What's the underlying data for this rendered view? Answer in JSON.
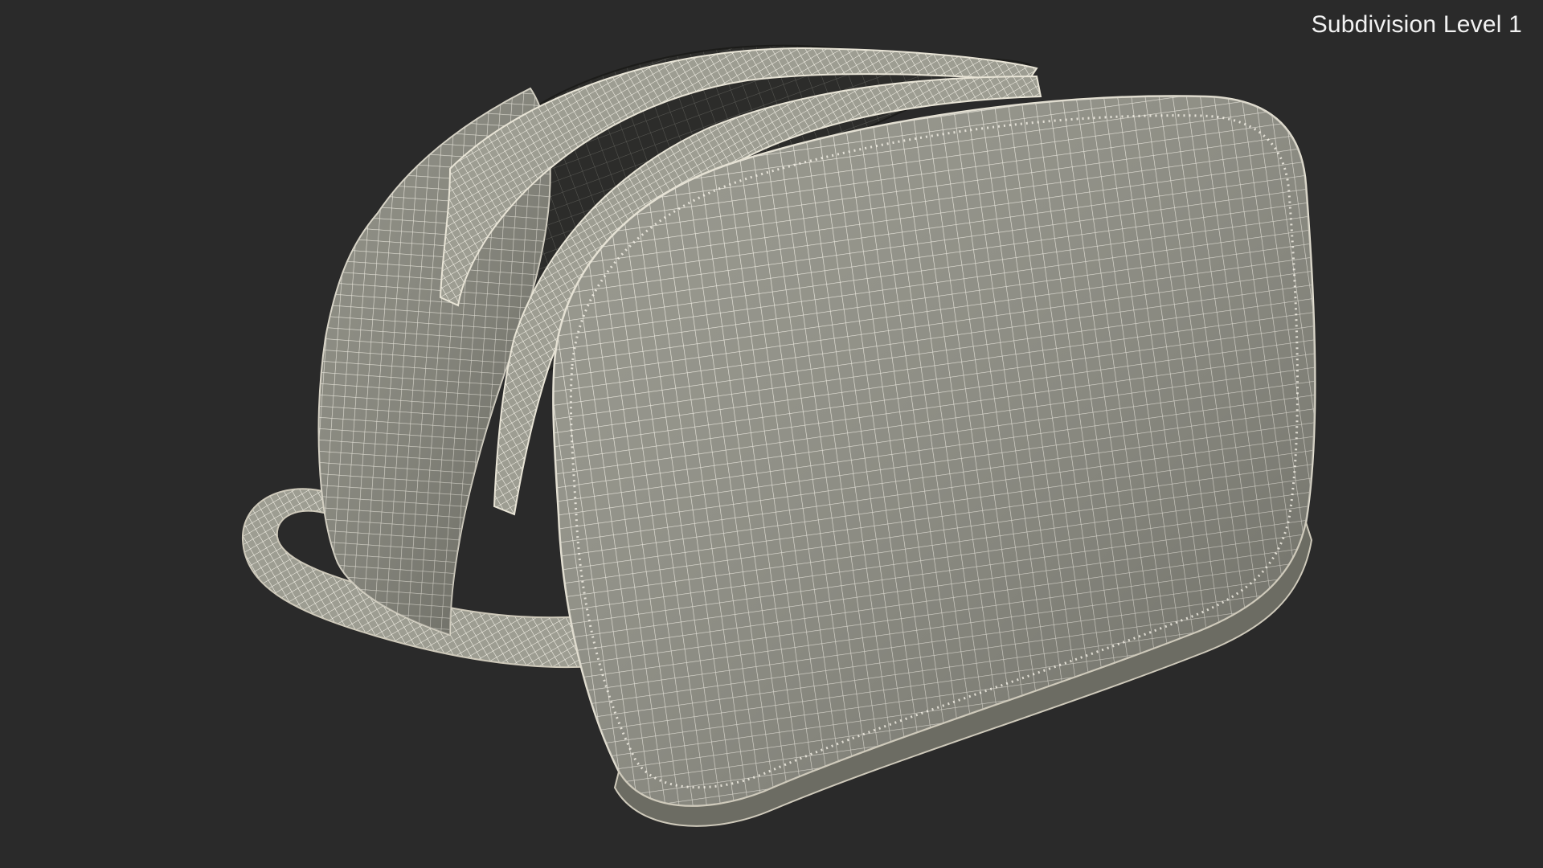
{
  "overlay": {
    "label": "Subdivision Level 1"
  },
  "scene": {
    "subject": "wireframe-toiletry-bag",
    "background_color": "#2a2a2a",
    "mesh_fill_color": "#8f8f84",
    "wire_color": "#f4f1e6"
  }
}
